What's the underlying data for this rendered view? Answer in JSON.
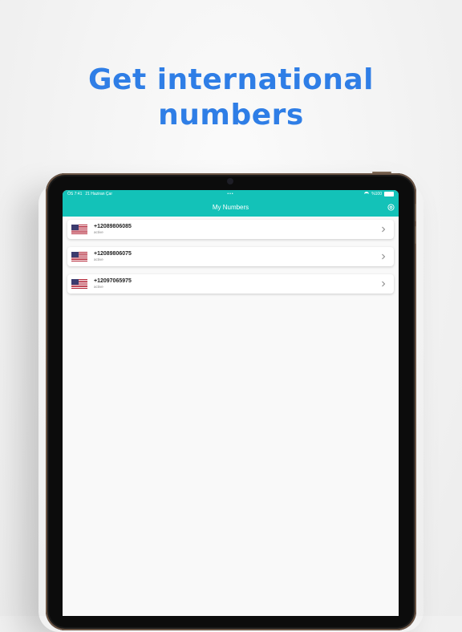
{
  "headline": {
    "line1": "Get international",
    "line2": "numbers"
  },
  "status_bar": {
    "time": "ÖS 7:41",
    "date": "21 Haziran Çar",
    "battery": "%100"
  },
  "nav": {
    "title": "My Numbers",
    "settings_icon": "settings-icon"
  },
  "numbers": [
    {
      "number": "+12089806085",
      "status": "active",
      "flag": "us-flag-icon"
    },
    {
      "number": "+12089806075",
      "status": "active",
      "flag": "us-flag-icon"
    },
    {
      "number": "+12097065975",
      "status": "active",
      "flag": "us-flag-icon"
    }
  ],
  "colors": {
    "accent": "#13c2b8",
    "headline": "#2f7ee6"
  }
}
